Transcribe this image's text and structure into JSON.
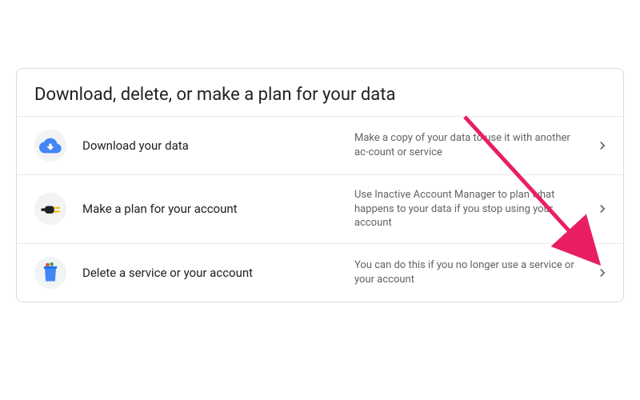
{
  "card": {
    "title": "Download, delete, or make a plan for your data",
    "rows": [
      {
        "icon": "cloud-download-icon",
        "title": "Download your data",
        "desc": "Make a copy of your data to use it with another ac‐count or service"
      },
      {
        "icon": "power-plug-icon",
        "title": "Make a plan for your account",
        "desc": "Use Inactive Account Manager to plan what happens to your data if you stop using your account"
      },
      {
        "icon": "trash-bin-icon",
        "title": "Delete a service or your account",
        "desc": "You can do this if you no longer use a service or your account"
      }
    ]
  }
}
